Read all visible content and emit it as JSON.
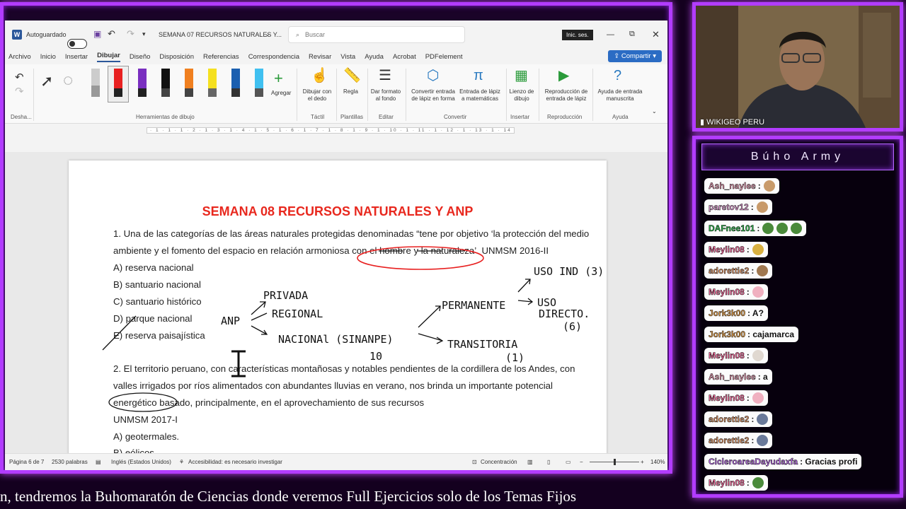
{
  "word": {
    "autosave_label": "Autoguardado",
    "doc_title": "SEMANA 07 RECURSOS NATURALES Y...",
    "search_placeholder": "Buscar",
    "signin_label": "Inic. ses.",
    "share_label": "Compartir",
    "menu": [
      "Archivo",
      "Inicio",
      "Insertar",
      "Dibujar",
      "Diseño",
      "Disposición",
      "Referencias",
      "Correspondencia",
      "Revisar",
      "Vista",
      "Ayuda",
      "Acrobat",
      "PDFelement"
    ],
    "active_menu": "Dibujar",
    "ribbon": {
      "undo_group": "Desha...",
      "drawing_tools_group": "Herramientas de dibujo",
      "add_label": "Agregar",
      "draw_finger": "Dibujar con el dedo",
      "tactil_group": "Táctil",
      "ruler_label": "Regla",
      "templates_group": "Plantillas",
      "bg_format": "Dar formato al fondo",
      "edit_group": "Editar",
      "ink_to_shape": "Convertir entrada de lápiz en forma",
      "ink_to_math": "Entrada de lápiz a matemáticas",
      "convert_group": "Convertir",
      "canvas_label": "Lienzo de dibujo",
      "insert_group": "Insertar",
      "replay_label": "Reproducción de entrada de lápiz",
      "replay_group": "Reproducción",
      "help_ink": "Ayuda de entrada manuscrita",
      "help_group": "Ayuda"
    },
    "ruler_ticks": "· 1 · 1 · 1 · 2 · 1 · 3 · 1 · 4 · 1 · 5 · 1 · 6 · 1 · 7 · 1 · 8 · 1 · 9 · 1 · 10 · 1 · 11 · 1 · 12 · 1 · 13 · 1 · 14 · 1 · 15 ·"
  },
  "document": {
    "title": "SEMANA 08 RECURSOS NATURALES Y ANP",
    "lines": [
      "1. Una de las categorías de las áreas naturales protegidas denominadas “tene por objetivo ‘la protección del medio",
      "ambiente y el fomento del espacio en relación armoniosa con el hombre y la naturaleza’. UNMSM 2016-II",
      "A) reserva nacional",
      "B) santuario nacional",
      "C) santuario histórico",
      "D) parque nacional",
      "E) reserva paisajística",
      "2. El territorio peruano, con características montañosas y notables pendientes de la cordillera de los Andes, con",
      "valles irrigados por ríos alimentados con abundantes lluvias en verano, nos brinda un importante potencial",
      "energético basado, principalmente, en el aprovechamiento de sus recursos",
      "UNMSM 2017-I",
      "A) geotermales.",
      "B) eólicos"
    ],
    "handwriting": {
      "anp": "ANP",
      "privada": "PRIVADA",
      "regional": "REGIONAL",
      "nacional": "NACIONAl (SINANPE)",
      "ten": "10",
      "permanente": "PERMANENTE",
      "transitoria": "TRANSITORIA",
      "one": "(1)",
      "uso_ind": "USO IND (3)",
      "uso": "USO",
      "directo": "DIRECTO.",
      "six": "(6)"
    }
  },
  "status": {
    "page": "Página 6 de 7",
    "words": "2530 palabras",
    "language": "Inglés (Estados Unidos)",
    "accessibility": "Accesibilidad: es necesario investigar",
    "focus": "Concentración",
    "zoom": "140%"
  },
  "stream": {
    "cam_label": "WIKIGEO PERU",
    "chat_title": "Búho Army",
    "ticker": "n, tendremos la Buhomaratón de Ciencias donde veremos Full Ejercicios solo de los Temas Fijos"
  },
  "chat": [
    {
      "user": "Ash_naylee",
      "user_color": "#f0a0b8",
      "text": ":",
      "emotes": [
        "#c89a6a"
      ]
    },
    {
      "user": "paretov12",
      "user_color": "#e8a0d8",
      "text": ":",
      "emotes": [
        "#c89a6a"
      ]
    },
    {
      "user": "DAFnee101",
      "user_color": "#2fbf4f",
      "text": ":",
      "emotes": [
        "#4a8a3a",
        "#4a8a3a",
        "#4a8a3a"
      ]
    },
    {
      "user": "Meylin08",
      "user_color": "#ff6aa0",
      "text": ":",
      "emotes": [
        "#d8b040"
      ]
    },
    {
      "user": "adorettie2",
      "user_color": "#e89a68",
      "text": ":",
      "emotes": [
        "#a07850"
      ]
    },
    {
      "user": "Meylin08",
      "user_color": "#ff6aa0",
      "text": ":",
      "emotes": [
        "#f0b0c0"
      ]
    },
    {
      "user": "Jork3k00",
      "user_color": "#e8a048",
      "text": ": A?",
      "emotes": []
    },
    {
      "user": "Jork3k00",
      "user_color": "#e8a048",
      "text": ": cajamarca",
      "emotes": []
    },
    {
      "user": "Meylin08",
      "user_color": "#ff6aa0",
      "text": ":",
      "emotes": [
        "#e0d8d0"
      ]
    },
    {
      "user": "Ash_naylee",
      "user_color": "#f0a0b8",
      "text": ": a",
      "emotes": []
    },
    {
      "user": "Meylin08",
      "user_color": "#ff6aa0",
      "text": ":",
      "emotes": [
        "#f0b0c0"
      ]
    },
    {
      "user": "adorettie2",
      "user_color": "#e89a68",
      "text": ":",
      "emotes": [
        "#6a7a9a"
      ]
    },
    {
      "user": "adorettie2",
      "user_color": "#e89a68",
      "text": ":",
      "emotes": [
        "#6a7a9a"
      ]
    },
    {
      "user": "CicleroareaDayudaxfa",
      "user_color": "#c070f0",
      "text": ": Gracias profi",
      "emotes": []
    },
    {
      "user": "Meylin08",
      "user_color": "#ff6aa0",
      "text": ":",
      "emotes": [
        "#4a8a3a"
      ]
    }
  ]
}
